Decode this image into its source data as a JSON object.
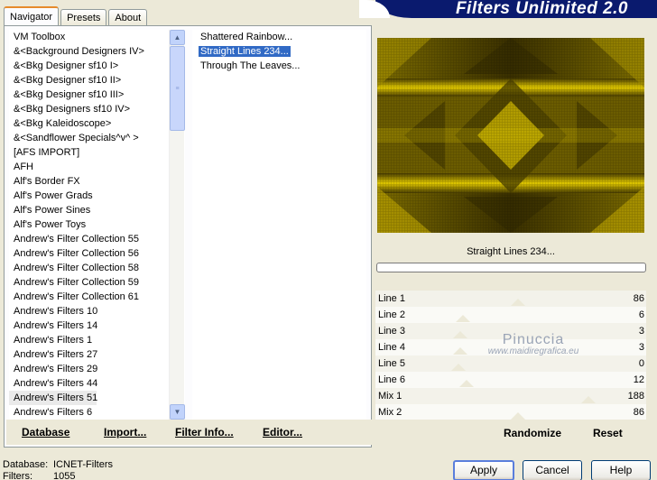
{
  "tabs": [
    {
      "label": "Navigator",
      "active": true
    },
    {
      "label": "Presets",
      "active": false
    },
    {
      "label": "About",
      "active": false
    }
  ],
  "banner_title": "Filters Unlimited 2.0",
  "categories": [
    "VM Toolbox",
    "&<Background Designers IV>",
    "&<Bkg Designer sf10 I>",
    "&<Bkg Designer sf10 II>",
    "&<Bkg Designer sf10 III>",
    "&<Bkg Designers sf10 IV>",
    "&<Bkg Kaleidoscope>",
    "&<Sandflower Specials^v^ >",
    "[AFS IMPORT]",
    "AFH",
    "Alf's Border FX",
    "Alf's Power Grads",
    "Alf's Power Sines",
    "Alf's Power Toys",
    "Andrew's Filter Collection 55",
    "Andrew's Filter Collection 56",
    "Andrew's Filter Collection 58",
    "Andrew's Filter Collection 59",
    "Andrew's Filter Collection 61",
    "Andrew's Filters 10",
    "Andrew's Filters 14",
    "Andrew's Filters 1",
    "Andrew's Filters 27",
    "Andrew's Filters 29",
    "Andrew's Filters 44",
    "Andrew's Filters 51",
    "Andrew's Filters 6"
  ],
  "selected_category": "Andrew's Filters 51",
  "filters": [
    "Shattered Rainbow...",
    "Straight Lines 234...",
    "Through The Leaves..."
  ],
  "selected_filter": "Straight Lines 234...",
  "left_buttons": {
    "database": "Database",
    "import": "Import...",
    "filter_info": "Filter Info...",
    "editor": "Editor..."
  },
  "current_filter_name": "Straight Lines 234...",
  "progress": 0,
  "params": [
    {
      "label": "Line 1",
      "value": "86",
      "level": 0.337
    },
    {
      "label": "Line 2",
      "value": "6",
      "level": 0.024
    },
    {
      "label": "Line 3",
      "value": "3",
      "level": 0.012
    },
    {
      "label": "Line 4",
      "value": "3",
      "level": 0.012
    },
    {
      "label": "Line 5",
      "value": "0",
      "level": 0.0
    },
    {
      "label": "Line 6",
      "value": "12",
      "level": 0.047
    },
    {
      "label": "Mix 1",
      "value": "188",
      "level": 0.737
    },
    {
      "label": "Mix 2",
      "value": "86",
      "level": 0.337
    }
  ],
  "watermark": {
    "title": "Pinuccia",
    "subtitle": "www.maidiregrafica.eu"
  },
  "right_buttons": {
    "randomize": "Randomize",
    "reset": "Reset"
  },
  "footer": {
    "database_label": "Database:",
    "database_value": "ICNET-Filters",
    "filters_label": "Filters:",
    "filters_value": "1055"
  },
  "dialog_buttons": {
    "apply": "Apply",
    "cancel": "Cancel",
    "help": "Help"
  },
  "preview_colors": {
    "dark": "#3d3300",
    "mid": "#8f7d00",
    "bright": "#e8d000"
  }
}
